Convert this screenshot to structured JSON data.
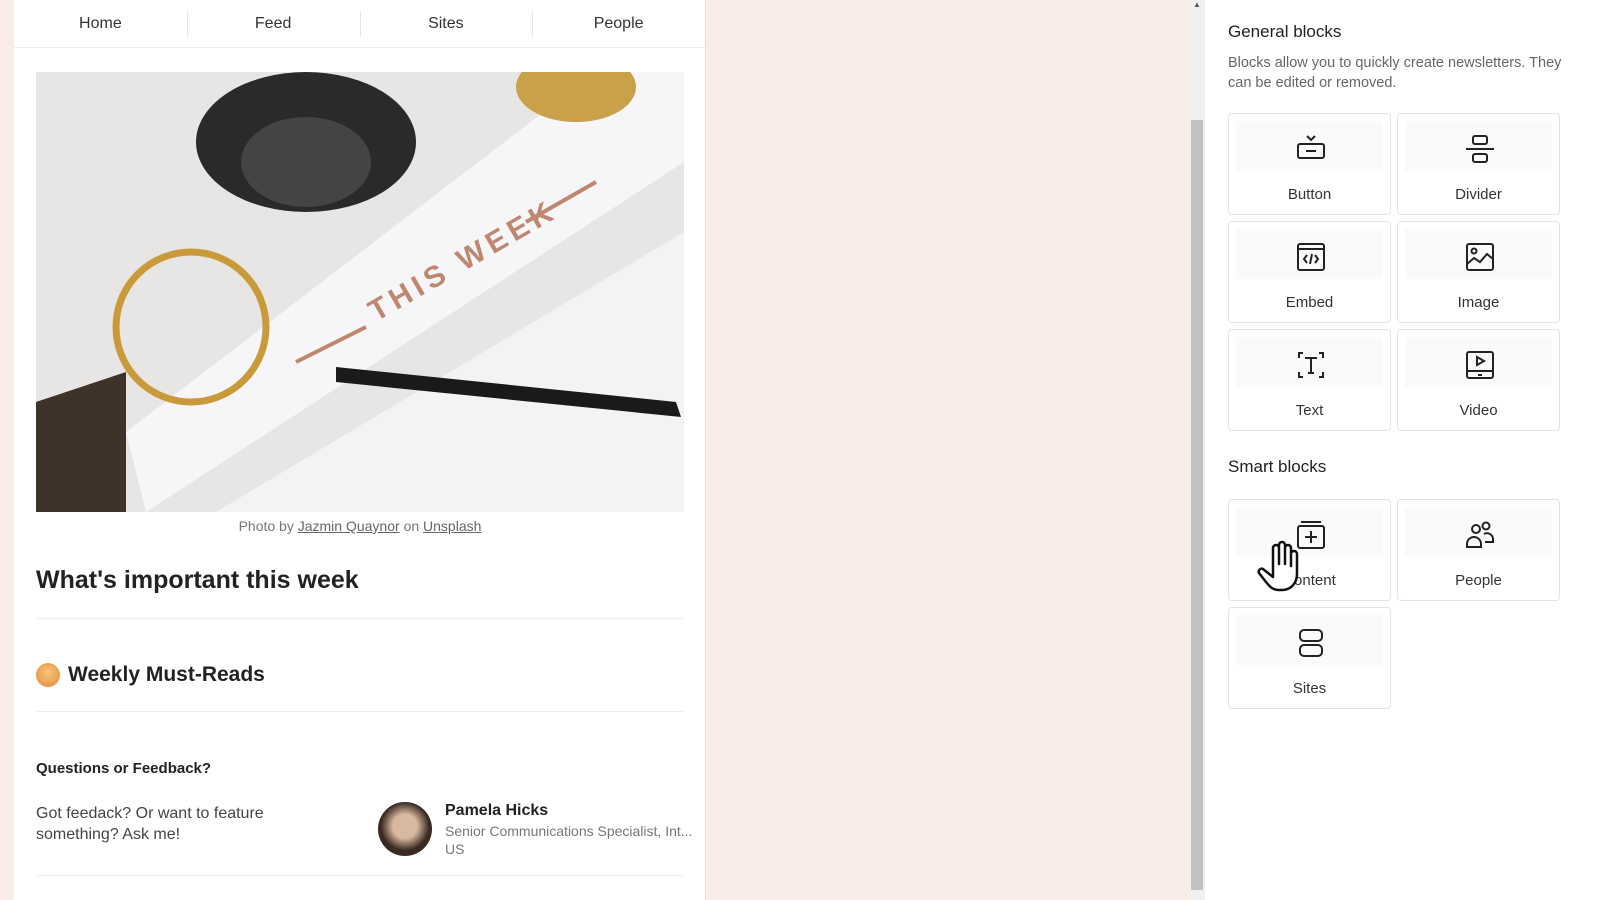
{
  "nav": {
    "items": [
      "Home",
      "Feed",
      "Sites",
      "People"
    ]
  },
  "newsletter": {
    "caption": {
      "prefix": "Photo by",
      "author": "Jazmin Quaynor",
      "mid": "on",
      "source": "Unsplash"
    },
    "photo_text": "THIS WEEK",
    "heading": "What's important this week",
    "section": "Weekly Must-Reads",
    "contact": {
      "heading": "Questions or Feedback?",
      "text": "Got feedack? Or want to feature something? Ask me!",
      "name": "Pamela Hicks",
      "title": "Senior Communications Specialist, Int...",
      "location": "US"
    }
  },
  "panel": {
    "general_title": "General blocks",
    "description": "Blocks allow you to quickly create newsletters. They can be edited or removed.",
    "general_blocks": [
      {
        "label": "Button",
        "icon": "button-icon"
      },
      {
        "label": "Divider",
        "icon": "divider-icon"
      },
      {
        "label": "Embed",
        "icon": "embed-icon"
      },
      {
        "label": "Image",
        "icon": "image-icon"
      },
      {
        "label": "Text",
        "icon": "text-icon"
      },
      {
        "label": "Video",
        "icon": "video-icon"
      }
    ],
    "smart_title": "Smart blocks",
    "smart_blocks": [
      {
        "label": "Content",
        "icon": "content-icon"
      },
      {
        "label": "People",
        "icon": "people-icon"
      },
      {
        "label": "Sites",
        "icon": "sites-icon"
      }
    ]
  }
}
